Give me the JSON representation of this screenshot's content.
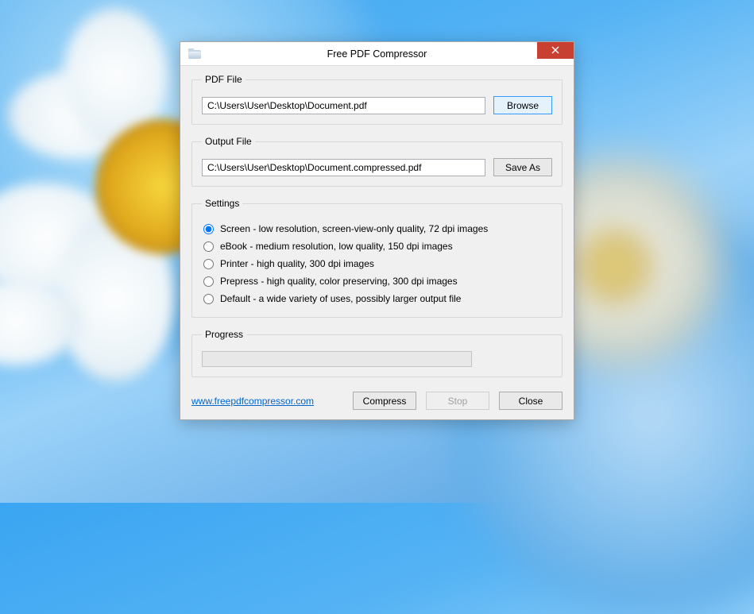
{
  "window": {
    "title": "Free PDF Compressor"
  },
  "pdf_file": {
    "legend": "PDF File",
    "path": "C:\\Users\\User\\Desktop\\Document.pdf",
    "browse_label": "Browse"
  },
  "output_file": {
    "legend": "Output File",
    "path": "C:\\Users\\User\\Desktop\\Document.compressed.pdf",
    "saveas_label": "Save As"
  },
  "settings": {
    "legend": "Settings",
    "options": [
      "Screen - low resolution, screen-view-only quality, 72 dpi images",
      "eBook - medium resolution, low quality, 150 dpi images",
      "Printer - high quality, 300 dpi images",
      "Prepress - high quality, color preserving, 300 dpi images",
      "Default - a wide variety of uses, possibly larger output file"
    ],
    "selected_index": 0
  },
  "progress": {
    "legend": "Progress"
  },
  "footer": {
    "link_text": "www.freepdfcompressor.com",
    "compress_label": "Compress",
    "stop_label": "Stop",
    "close_label": "Close"
  }
}
